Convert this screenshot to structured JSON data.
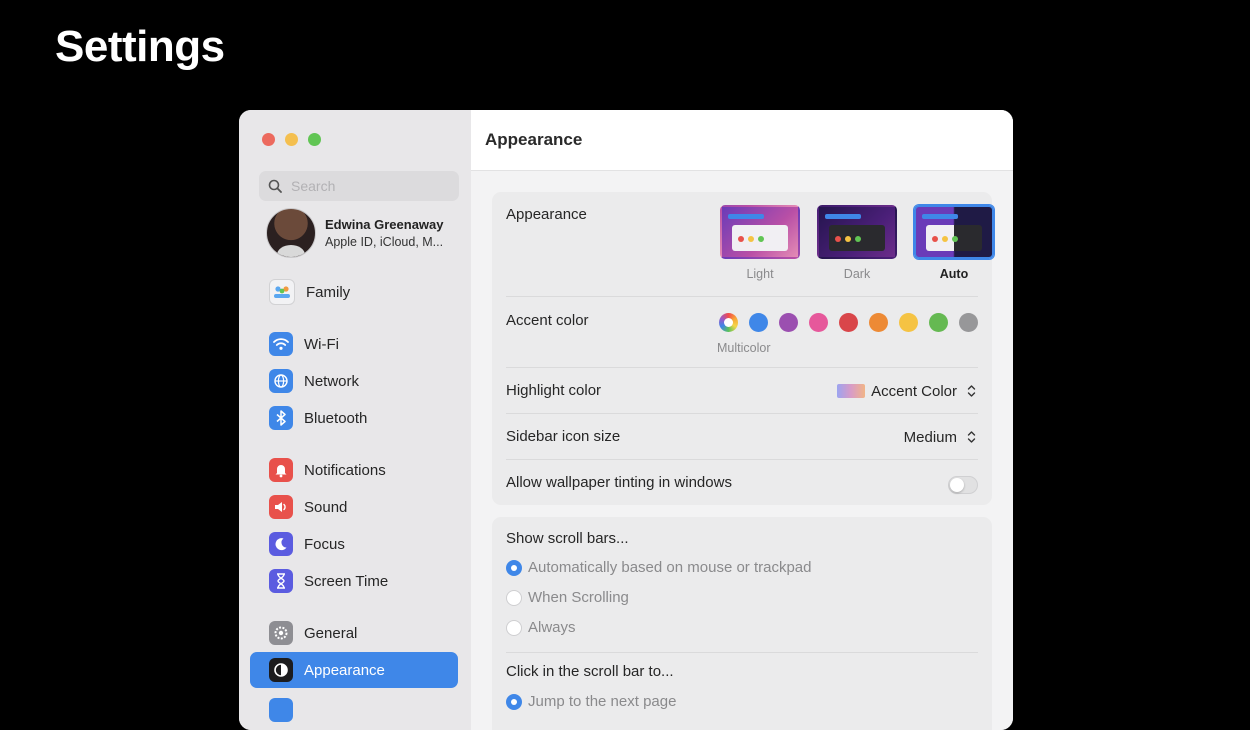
{
  "slide": {
    "title": "Settings"
  },
  "window": {
    "sidebar": {
      "search_placeholder": "Search",
      "profile": {
        "name": "Edwina Greenaway",
        "subtitle": "Apple ID, iCloud, M..."
      },
      "items": [
        {
          "label": "Family",
          "icon": "family-icon",
          "color": "#f2f2f4"
        },
        {
          "label": "Wi-Fi",
          "icon": "wifi-icon",
          "color": "#3f87e8"
        },
        {
          "label": "Network",
          "icon": "globe-icon",
          "color": "#3f87e8"
        },
        {
          "label": "Bluetooth",
          "icon": "bluetooth-icon",
          "color": "#3f87e8"
        },
        {
          "label": "Notifications",
          "icon": "bell-icon",
          "color": "#e8514b"
        },
        {
          "label": "Sound",
          "icon": "speaker-icon",
          "color": "#e8514b"
        },
        {
          "label": "Focus",
          "icon": "moon-icon",
          "color": "#5b5ce0"
        },
        {
          "label": "Screen Time",
          "icon": "hourglass-icon",
          "color": "#5b5ce0"
        },
        {
          "label": "General",
          "icon": "gear-icon",
          "color": "#8e8e93"
        },
        {
          "label": "Appearance",
          "icon": "appearance-icon",
          "color": "#1c1c1e",
          "selected": true
        }
      ]
    },
    "main": {
      "title": "Appearance",
      "appearance": {
        "label": "Appearance",
        "options": [
          {
            "label": "Light",
            "selected": false
          },
          {
            "label": "Dark",
            "selected": false
          },
          {
            "label": "Auto",
            "selected": true
          }
        ]
      },
      "accent": {
        "label": "Accent color",
        "selected_label": "Multicolor",
        "colors": [
          "multicolor",
          "#3f87e8",
          "#9b4fb0",
          "#e6589b",
          "#d9464a",
          "#ed8a35",
          "#f5c343",
          "#65b952",
          "#979799"
        ]
      },
      "highlight": {
        "label": "Highlight color",
        "value": "Accent Color"
      },
      "sidebar_icon_size": {
        "label": "Sidebar icon size",
        "value": "Medium"
      },
      "wallpaper_tinting": {
        "label": "Allow wallpaper tinting in windows",
        "enabled": false
      },
      "scroll_bars": {
        "label": "Show scroll bars...",
        "options": [
          {
            "label": "Automatically based on mouse or trackpad",
            "checked": true
          },
          {
            "label": "When Scrolling",
            "checked": false
          },
          {
            "label": "Always",
            "checked": false
          }
        ]
      },
      "click_scroll": {
        "label": "Click in the scroll bar to...",
        "options": [
          {
            "label": "Jump to the next page",
            "checked": true
          }
        ]
      }
    }
  }
}
